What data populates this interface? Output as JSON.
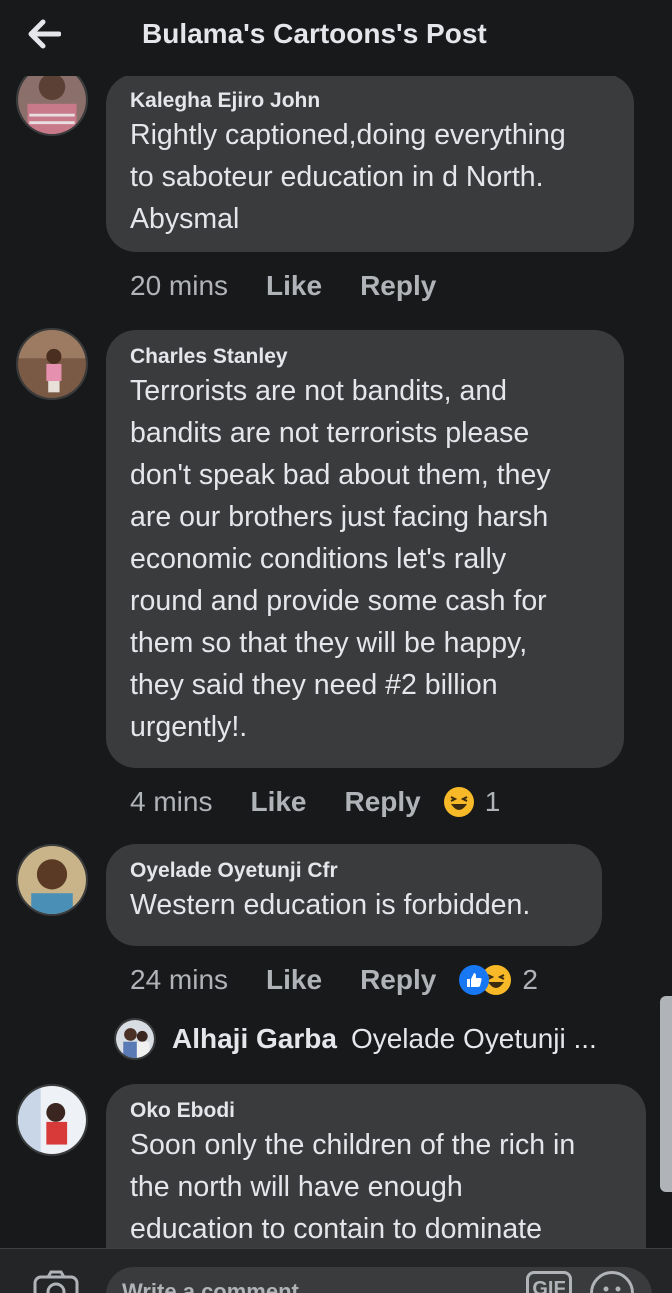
{
  "header": {
    "title": "Bulama's Cartoons's Post"
  },
  "comments": [
    {
      "author": "Kalegha Ejiro John",
      "text": "Rightly captioned,doing everything\nto saboteur education in d North.\nAbysmal",
      "time": "20 mins",
      "like": "Like",
      "reply": "Reply"
    },
    {
      "author": "Charles Stanley",
      "text": "Terrorists are not bandits, and\nbandits are not terrorists please\ndon't speak bad about them, they\nare our brothers just facing harsh\neconomic conditions let's rally\nround and provide some cash for\nthem so that they will be happy,\nthey said they need #2 billion\nurgently!.",
      "time": "4 mins",
      "like": "Like",
      "reply": "Reply",
      "reactions": {
        "icons": [
          "haha-icon"
        ],
        "count": "1"
      }
    },
    {
      "author": "Oyelade Oyetunji Cfr",
      "text": "Western education is forbidden.",
      "time": "24 mins",
      "like": "Like",
      "reply": "Reply",
      "reactions": {
        "icons": [
          "like-icon",
          "haha-icon"
        ],
        "count": "2"
      }
    },
    {
      "author": "Oko Ebodi",
      "text": "Soon only the children of the rich in\nthe north will have enough\neducation to contain to dominate"
    }
  ],
  "reply_preview": {
    "name": "Alhaji Garba",
    "text": "Oyelade Oyetunji ..."
  },
  "composer": {
    "placeholder": "Write a comment...",
    "gif_label": "GIF"
  },
  "colors": {
    "background": "#18191a",
    "bubble": "#3a3b3c",
    "text": "#e4e6eb",
    "secondary_text": "#b0b3b8",
    "like_blue": "#1877f2",
    "haha_yellow": "#f7b928"
  }
}
